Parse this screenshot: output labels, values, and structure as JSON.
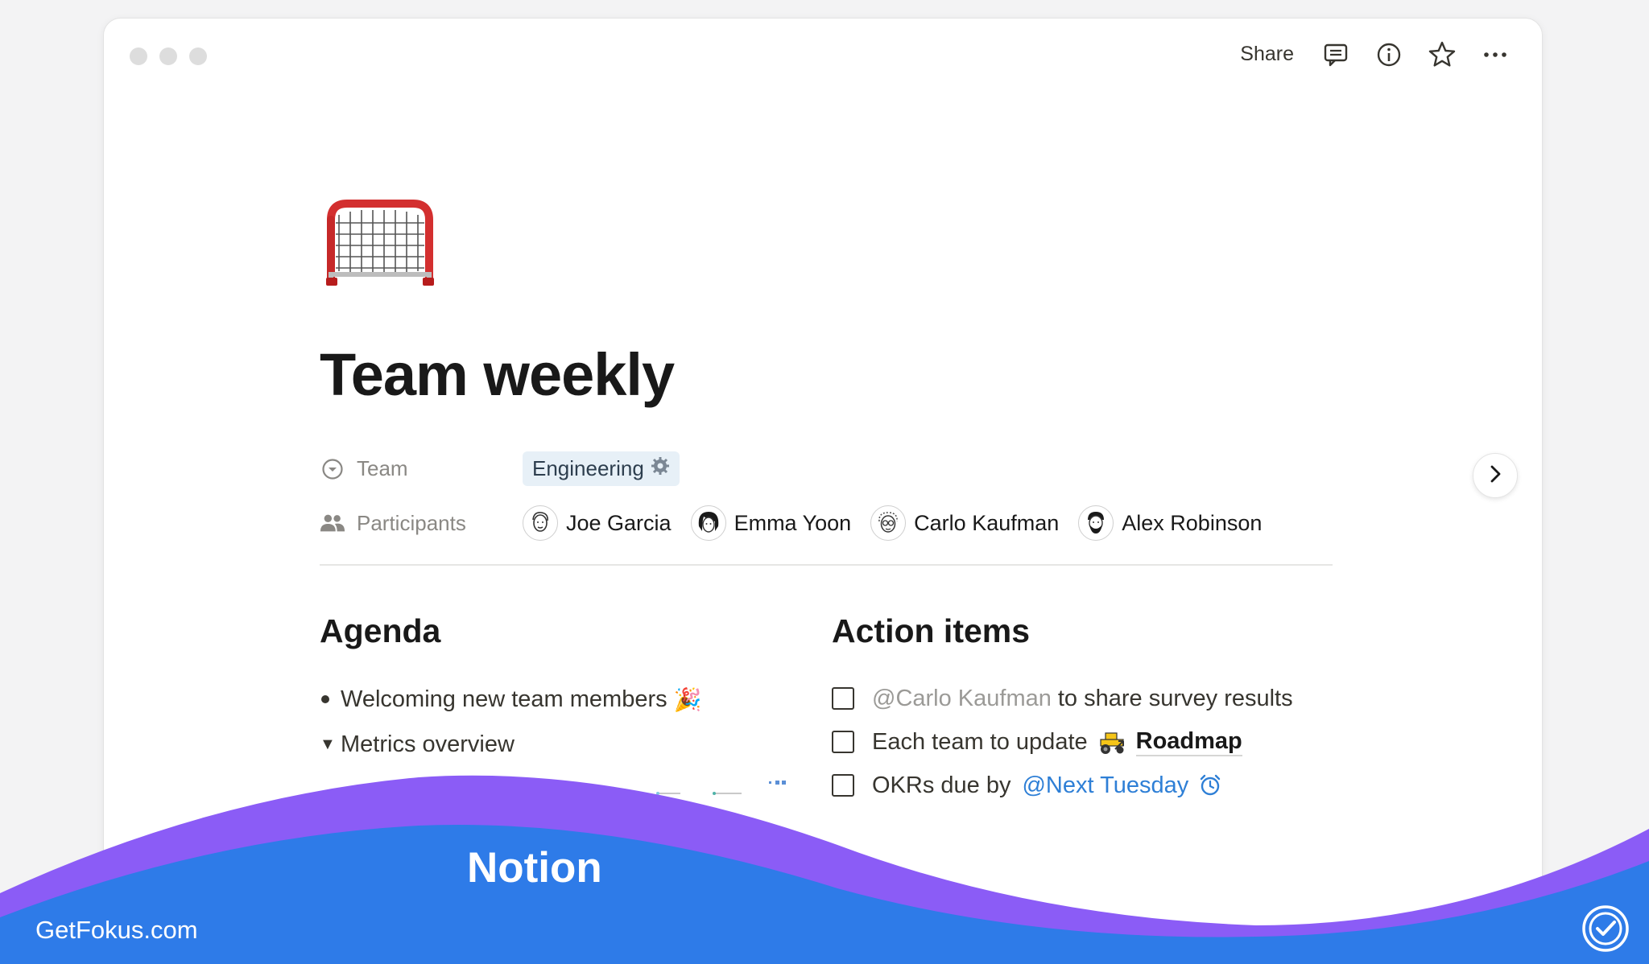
{
  "topbar": {
    "share_label": "Share",
    "icons": [
      "comment-icon",
      "info-icon",
      "star-icon",
      "more-icon"
    ]
  },
  "page": {
    "icon": "goal-net-emoji",
    "title": "Team weekly"
  },
  "properties": {
    "team": {
      "label": "Team",
      "value": "Engineering",
      "value_icon": "gear-icon",
      "tag_color": "#e7f0f7"
    },
    "participants": {
      "label": "Participants",
      "people": [
        {
          "name": "Joe Garcia"
        },
        {
          "name": "Emma Yoon"
        },
        {
          "name": "Carlo Kaufman"
        },
        {
          "name": "Alex Robinson"
        }
      ]
    }
  },
  "agenda": {
    "heading": "Agenda",
    "items": [
      {
        "text": "Welcoming new team members",
        "emoji": "🎉",
        "type": "bullet"
      },
      {
        "text": "Metrics overview",
        "type": "toggle"
      }
    ]
  },
  "actions": {
    "heading": "Action items",
    "items": [
      {
        "mention": "@Carlo Kaufman",
        "text": "to share survey results"
      },
      {
        "text": "Each team to update",
        "link_icon": "tractor-icon",
        "link": "Roadmap"
      },
      {
        "text": "OKRs due by",
        "date": "@Next Tuesday",
        "date_icon": "alarm-clock-icon"
      }
    ]
  },
  "banner": {
    "brand": "Notion",
    "site": "GetFokus.com",
    "colors": {
      "blue": "#2e7be8",
      "purple": "#8b5cf6"
    }
  }
}
